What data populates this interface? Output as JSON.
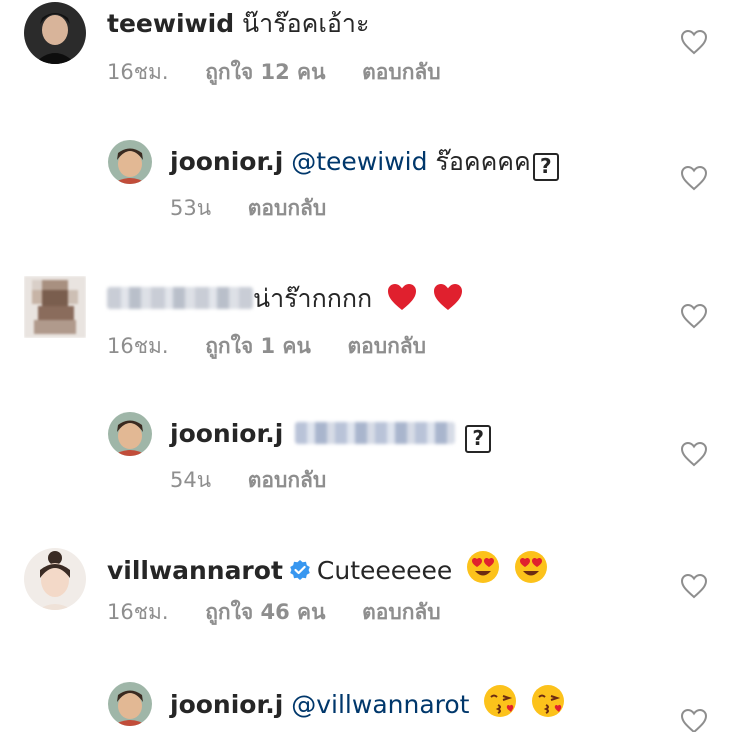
{
  "comments": [
    {
      "username": "teewiwid",
      "text": "น๊าร๊อคเอ้าะ",
      "time": "16ชม.",
      "likes": "ถูกใจ 12 คน",
      "reply": "ตอบกลับ"
    },
    {
      "username": "joonior.j",
      "mention": "@teewiwid",
      "text": "ร๊อคคคค",
      "missing_glyph": "?",
      "time": "53น",
      "reply": "ตอบกลับ"
    },
    {
      "username": "",
      "text": "น่าร๊ากกกก",
      "emoji": [
        "heart-emoji",
        "heart-emoji"
      ],
      "time": "16ชม.",
      "likes": "ถูกใจ 1 คน",
      "reply": "ตอบกลับ"
    },
    {
      "username": "joonior.j",
      "missing_glyph": "?",
      "time": "54น",
      "reply": "ตอบกลับ"
    },
    {
      "username": "villwannarot",
      "verified": true,
      "text": "Cuteeeeee",
      "emoji": [
        "heart-eyes-emoji",
        "heart-eyes-emoji"
      ],
      "time": "16ชม.",
      "likes": "ถูกใจ 46 คน",
      "reply": "ตอบกลับ"
    },
    {
      "username": "joonior.j",
      "mention": "@villwannarot",
      "emoji": [
        "kissing-emoji",
        "kissing-emoji"
      ]
    }
  ],
  "colors": {
    "text": "#262626",
    "meta": "#8e8e8e",
    "mention": "#00376b",
    "verified": "#3897f0",
    "heart_emoji": "#e0202e"
  },
  "icons": {
    "like": "heart-outline-icon"
  }
}
